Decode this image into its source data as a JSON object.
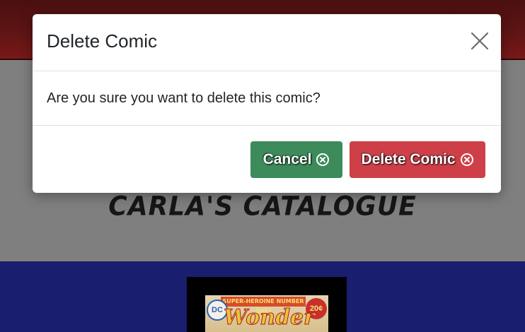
{
  "background": {
    "catalogue_title": "Carla's Catalogue",
    "comic_cover": {
      "banner": "SUPER-HEROINE NUMBER ONE!",
      "logo": "DC",
      "price": "20¢",
      "title": "Wonder"
    }
  },
  "modal": {
    "title": "Delete Comic",
    "message": "Are you sure you want to delete this comic?",
    "cancel_label": "Cancel",
    "delete_label": "Delete Comic",
    "close_icon": "close-icon",
    "button_icon": "circle-x-icon"
  },
  "colors": {
    "topbar": "#611515",
    "backdrop": "#808080",
    "bottom_band": "#1a1e6e",
    "cancel_button": "#3d8b5a",
    "delete_button": "#cf3f48"
  }
}
